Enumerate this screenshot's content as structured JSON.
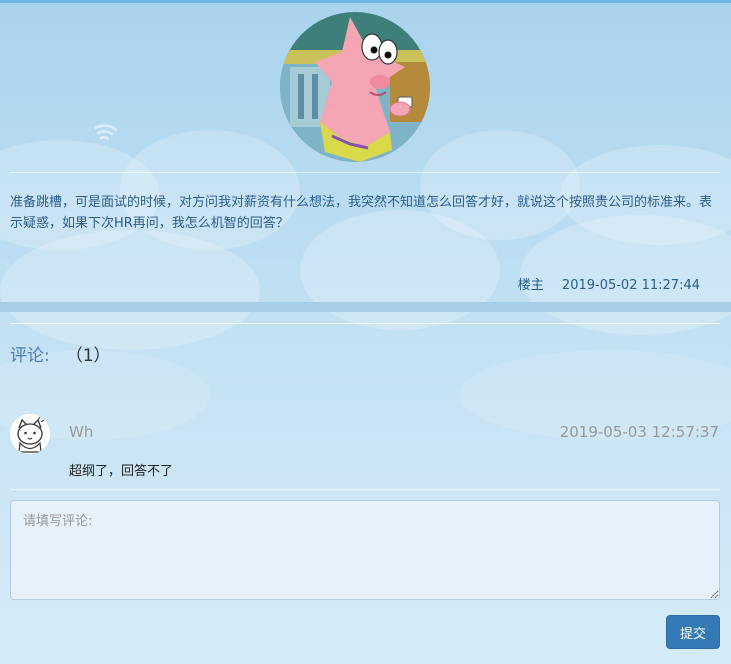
{
  "question": {
    "text": "准备跳槽，可是面试的时候，对方问我对薪资有什么想法，我突然不知道怎么回答才好，就说这个按照贵公司的标准来。表示疑惑，如果下次HR再问，我怎么机智的回答？",
    "author_label": "楼主",
    "timestamp": "2019-05-02 11:27:44"
  },
  "comments": {
    "title": "评论:",
    "count": "（1）",
    "items": [
      {
        "name": "Wh",
        "timestamp": "2019-05-03 12:57:37",
        "text": "超纲了，回答不了"
      }
    ]
  },
  "form": {
    "placeholder": "请填写评论:",
    "submit_label": "提交"
  }
}
